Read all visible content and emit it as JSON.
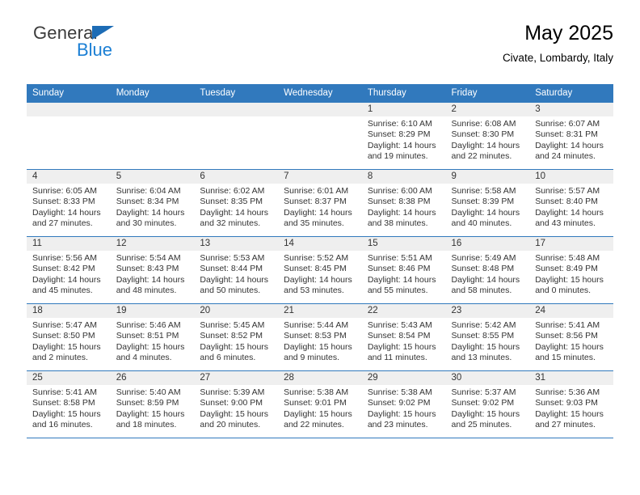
{
  "brand": {
    "name_top": "General",
    "name_bottom": "Blue",
    "triangle_color": "#1d6cb5",
    "blue_color": "#1b7fd4"
  },
  "header": {
    "title": "May 2025",
    "subtitle": "Civate, Lombardy, Italy"
  },
  "theme": {
    "header_bg": "#3179bd",
    "header_text": "#ffffff",
    "daynum_bg": "#efefef",
    "row_divider": "#3179bd"
  },
  "labels": {
    "sunrise": "Sunrise:",
    "sunset": "Sunset:",
    "daylight": "Daylight:"
  },
  "weekdays": [
    "Sunday",
    "Monday",
    "Tuesday",
    "Wednesday",
    "Thursday",
    "Friday",
    "Saturday"
  ],
  "weeks": [
    [
      {
        "empty": true
      },
      {
        "empty": true
      },
      {
        "empty": true
      },
      {
        "empty": true
      },
      {
        "day": "1",
        "sunrise": "Sunrise: 6:10 AM",
        "sunset": "Sunset: 8:29 PM",
        "daylight_l1": "Daylight: 14 hours",
        "daylight_l2": "and 19 minutes."
      },
      {
        "day": "2",
        "sunrise": "Sunrise: 6:08 AM",
        "sunset": "Sunset: 8:30 PM",
        "daylight_l1": "Daylight: 14 hours",
        "daylight_l2": "and 22 minutes."
      },
      {
        "day": "3",
        "sunrise": "Sunrise: 6:07 AM",
        "sunset": "Sunset: 8:31 PM",
        "daylight_l1": "Daylight: 14 hours",
        "daylight_l2": "and 24 minutes."
      }
    ],
    [
      {
        "day": "4",
        "sunrise": "Sunrise: 6:05 AM",
        "sunset": "Sunset: 8:33 PM",
        "daylight_l1": "Daylight: 14 hours",
        "daylight_l2": "and 27 minutes."
      },
      {
        "day": "5",
        "sunrise": "Sunrise: 6:04 AM",
        "sunset": "Sunset: 8:34 PM",
        "daylight_l1": "Daylight: 14 hours",
        "daylight_l2": "and 30 minutes."
      },
      {
        "day": "6",
        "sunrise": "Sunrise: 6:02 AM",
        "sunset": "Sunset: 8:35 PM",
        "daylight_l1": "Daylight: 14 hours",
        "daylight_l2": "and 32 minutes."
      },
      {
        "day": "7",
        "sunrise": "Sunrise: 6:01 AM",
        "sunset": "Sunset: 8:37 PM",
        "daylight_l1": "Daylight: 14 hours",
        "daylight_l2": "and 35 minutes."
      },
      {
        "day": "8",
        "sunrise": "Sunrise: 6:00 AM",
        "sunset": "Sunset: 8:38 PM",
        "daylight_l1": "Daylight: 14 hours",
        "daylight_l2": "and 38 minutes."
      },
      {
        "day": "9",
        "sunrise": "Sunrise: 5:58 AM",
        "sunset": "Sunset: 8:39 PM",
        "daylight_l1": "Daylight: 14 hours",
        "daylight_l2": "and 40 minutes."
      },
      {
        "day": "10",
        "sunrise": "Sunrise: 5:57 AM",
        "sunset": "Sunset: 8:40 PM",
        "daylight_l1": "Daylight: 14 hours",
        "daylight_l2": "and 43 minutes."
      }
    ],
    [
      {
        "day": "11",
        "sunrise": "Sunrise: 5:56 AM",
        "sunset": "Sunset: 8:42 PM",
        "daylight_l1": "Daylight: 14 hours",
        "daylight_l2": "and 45 minutes."
      },
      {
        "day": "12",
        "sunrise": "Sunrise: 5:54 AM",
        "sunset": "Sunset: 8:43 PM",
        "daylight_l1": "Daylight: 14 hours",
        "daylight_l2": "and 48 minutes."
      },
      {
        "day": "13",
        "sunrise": "Sunrise: 5:53 AM",
        "sunset": "Sunset: 8:44 PM",
        "daylight_l1": "Daylight: 14 hours",
        "daylight_l2": "and 50 minutes."
      },
      {
        "day": "14",
        "sunrise": "Sunrise: 5:52 AM",
        "sunset": "Sunset: 8:45 PM",
        "daylight_l1": "Daylight: 14 hours",
        "daylight_l2": "and 53 minutes."
      },
      {
        "day": "15",
        "sunrise": "Sunrise: 5:51 AM",
        "sunset": "Sunset: 8:46 PM",
        "daylight_l1": "Daylight: 14 hours",
        "daylight_l2": "and 55 minutes."
      },
      {
        "day": "16",
        "sunrise": "Sunrise: 5:49 AM",
        "sunset": "Sunset: 8:48 PM",
        "daylight_l1": "Daylight: 14 hours",
        "daylight_l2": "and 58 minutes."
      },
      {
        "day": "17",
        "sunrise": "Sunrise: 5:48 AM",
        "sunset": "Sunset: 8:49 PM",
        "daylight_l1": "Daylight: 15 hours",
        "daylight_l2": "and 0 minutes."
      }
    ],
    [
      {
        "day": "18",
        "sunrise": "Sunrise: 5:47 AM",
        "sunset": "Sunset: 8:50 PM",
        "daylight_l1": "Daylight: 15 hours",
        "daylight_l2": "and 2 minutes."
      },
      {
        "day": "19",
        "sunrise": "Sunrise: 5:46 AM",
        "sunset": "Sunset: 8:51 PM",
        "daylight_l1": "Daylight: 15 hours",
        "daylight_l2": "and 4 minutes."
      },
      {
        "day": "20",
        "sunrise": "Sunrise: 5:45 AM",
        "sunset": "Sunset: 8:52 PM",
        "daylight_l1": "Daylight: 15 hours",
        "daylight_l2": "and 6 minutes."
      },
      {
        "day": "21",
        "sunrise": "Sunrise: 5:44 AM",
        "sunset": "Sunset: 8:53 PM",
        "daylight_l1": "Daylight: 15 hours",
        "daylight_l2": "and 9 minutes."
      },
      {
        "day": "22",
        "sunrise": "Sunrise: 5:43 AM",
        "sunset": "Sunset: 8:54 PM",
        "daylight_l1": "Daylight: 15 hours",
        "daylight_l2": "and 11 minutes."
      },
      {
        "day": "23",
        "sunrise": "Sunrise: 5:42 AM",
        "sunset": "Sunset: 8:55 PM",
        "daylight_l1": "Daylight: 15 hours",
        "daylight_l2": "and 13 minutes."
      },
      {
        "day": "24",
        "sunrise": "Sunrise: 5:41 AM",
        "sunset": "Sunset: 8:56 PM",
        "daylight_l1": "Daylight: 15 hours",
        "daylight_l2": "and 15 minutes."
      }
    ],
    [
      {
        "day": "25",
        "sunrise": "Sunrise: 5:41 AM",
        "sunset": "Sunset: 8:58 PM",
        "daylight_l1": "Daylight: 15 hours",
        "daylight_l2": "and 16 minutes."
      },
      {
        "day": "26",
        "sunrise": "Sunrise: 5:40 AM",
        "sunset": "Sunset: 8:59 PM",
        "daylight_l1": "Daylight: 15 hours",
        "daylight_l2": "and 18 minutes."
      },
      {
        "day": "27",
        "sunrise": "Sunrise: 5:39 AM",
        "sunset": "Sunset: 9:00 PM",
        "daylight_l1": "Daylight: 15 hours",
        "daylight_l2": "and 20 minutes."
      },
      {
        "day": "28",
        "sunrise": "Sunrise: 5:38 AM",
        "sunset": "Sunset: 9:01 PM",
        "daylight_l1": "Daylight: 15 hours",
        "daylight_l2": "and 22 minutes."
      },
      {
        "day": "29",
        "sunrise": "Sunrise: 5:38 AM",
        "sunset": "Sunset: 9:02 PM",
        "daylight_l1": "Daylight: 15 hours",
        "daylight_l2": "and 23 minutes."
      },
      {
        "day": "30",
        "sunrise": "Sunrise: 5:37 AM",
        "sunset": "Sunset: 9:02 PM",
        "daylight_l1": "Daylight: 15 hours",
        "daylight_l2": "and 25 minutes."
      },
      {
        "day": "31",
        "sunrise": "Sunrise: 5:36 AM",
        "sunset": "Sunset: 9:03 PM",
        "daylight_l1": "Daylight: 15 hours",
        "daylight_l2": "and 27 minutes."
      }
    ]
  ]
}
